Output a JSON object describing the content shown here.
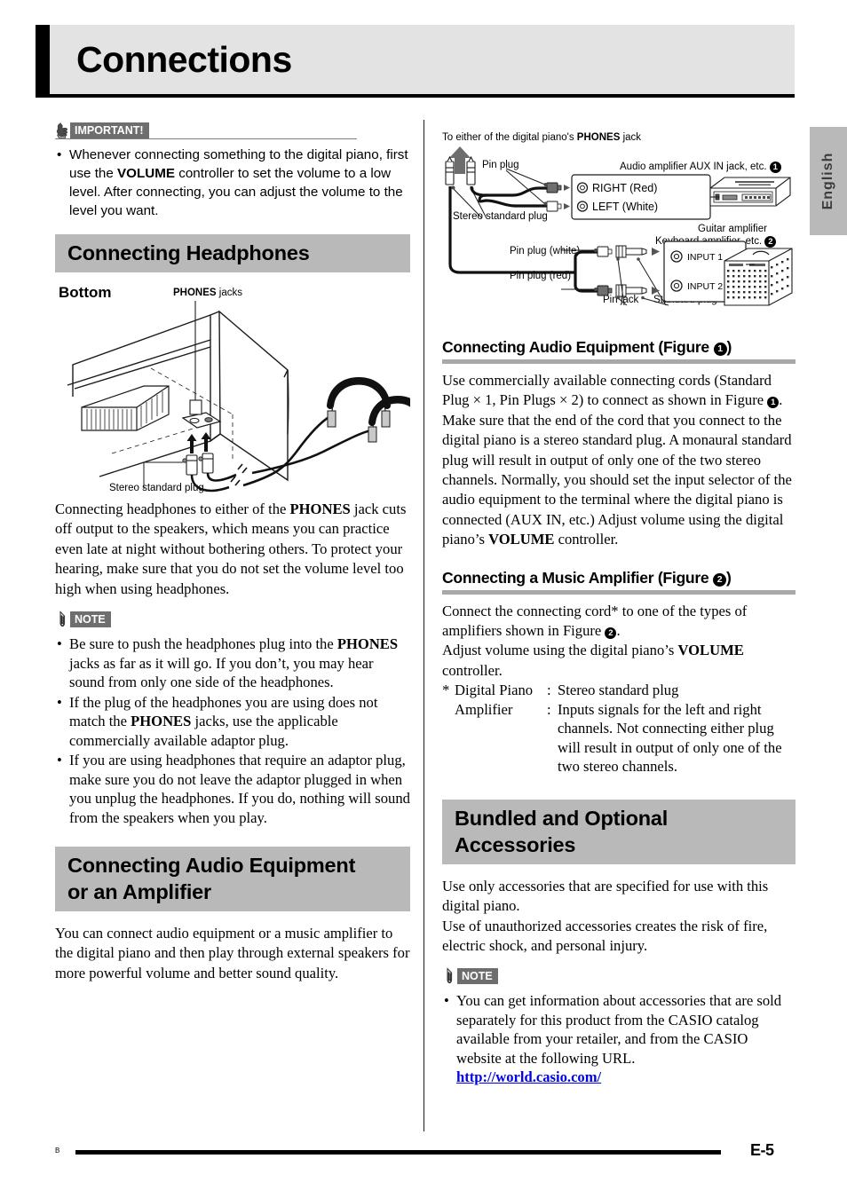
{
  "page": {
    "chapter_title": "Connections",
    "language_tab": "English",
    "footer_mark": "B",
    "footer_page": "E-5"
  },
  "important": {
    "badge_label": "IMPORTANT!",
    "bullets": [
      "Whenever connecting something to the digital piano, first use the VOLUME controller to set the volume to a low level. After connecting, you can adjust the volume to the level you want."
    ]
  },
  "headphones": {
    "heading": "Connecting Headphones",
    "figure": {
      "bottom_label": "Bottom",
      "phones_jacks_label_bold": "PHONES",
      "phones_jacks_label_rest": " jacks",
      "stereo_plug_label": "Stereo standard plug"
    },
    "paragraph": "Connecting headphones to either of the PHONES jack cuts off output to the speakers, which means you can practice even late at night without bothering others. To protect your hearing, make sure that you do not set the volume level too high when using headphones.",
    "note_badge": "NOTE",
    "note_bullets": [
      "Be sure to push the headphones plug into the PHONES jacks as far as it will go. If you don't, you may hear sound from only one side of the headphones.",
      "If the plug of the headphones you are using does not match the PHONES jacks, use the applicable commercially available adaptor plug.",
      "If you are using headphones that require an adaptor plug, make sure you do not leave the adaptor plugged in when you unplug the headphones. If you do, nothing will sound from the speakers when you play."
    ]
  },
  "audio_equipment": {
    "heading_line1": "Connecting Audio Equipment",
    "heading_line2": "or an Amplifier",
    "paragraph": "You can connect audio equipment or a music amplifier to the digital piano and then play through external speakers for more powerful volume and better sound quality."
  },
  "connection_figure": {
    "top_caption_pre": "To either of the digital piano's ",
    "top_caption_bold": "PHONES",
    "top_caption_post": " jack",
    "pin_plug": "Pin plug",
    "stereo_standard_plug": "Stereo standard plug",
    "aux_label": "Audio amplifier AUX IN jack, etc.",
    "aux_fignum": "1",
    "right_red": "RIGHT (Red)",
    "left_white": "LEFT (White)",
    "guitar_amp_line1": "Guitar amplifier",
    "guitar_amp_line2": "Keyboard amplifier, etc.",
    "guitar_fignum": "2",
    "pin_plug_white": "Pin plug (white)",
    "pin_plug_red": "Pin plug (red)",
    "input1": "INPUT 1",
    "input2": "INPUT 2",
    "pin_jack": "Pin jack",
    "standard_plug": "Standard plug"
  },
  "audio_section": {
    "heading_pre": "Connecting Audio Equipment (Figure ",
    "heading_fignum": "1",
    "heading_post": ")",
    "paragraph": "Use commercially available connecting cords (Standard Plug × 1, Pin Plugs × 2) to connect as shown in Figure ❶. Make sure that the end of the cord that you connect to the digital piano is a stereo standard plug. A monaural standard plug will result in output of only one of the two stereo channels. Normally, you should set the input selector of the audio equipment to the terminal where the digital piano is connected (AUX IN, etc.) Adjust volume using the digital piano's VOLUME controller."
  },
  "amplifier_section": {
    "heading_pre": "Connecting a Music Amplifier (Figure ",
    "heading_fignum": "2",
    "heading_post": ")",
    "para1_pre": "Connect the connecting cord* to one of the types of amplifiers shown in Figure ",
    "para1_post": ".",
    "para2": "Adjust volume using the digital piano's VOLUME controller.",
    "def_star": "*",
    "def_term1": "Digital Piano",
    "def_colon": ":",
    "def_desc1": "Stereo standard plug",
    "def_term2": "Amplifier",
    "def_desc2": "Inputs signals for the left and right channels. Not connecting either plug will result in output of only one of the two stereo channels."
  },
  "accessories": {
    "heading_line1": "Bundled and Optional",
    "heading_line2": "Accessories",
    "paragraph1": "Use only accessories that are specified for use with this digital piano.",
    "paragraph2": "Use of unauthorized accessories creates the risk of fire, electric shock, and personal injury.",
    "note_badge": "NOTE",
    "note_bullet": "You can get information about accessories that are sold separately for this product from the CASIO catalog available from your retailer, and from the CASIO website at the following URL.",
    "url": "http://world.casio.com/"
  }
}
